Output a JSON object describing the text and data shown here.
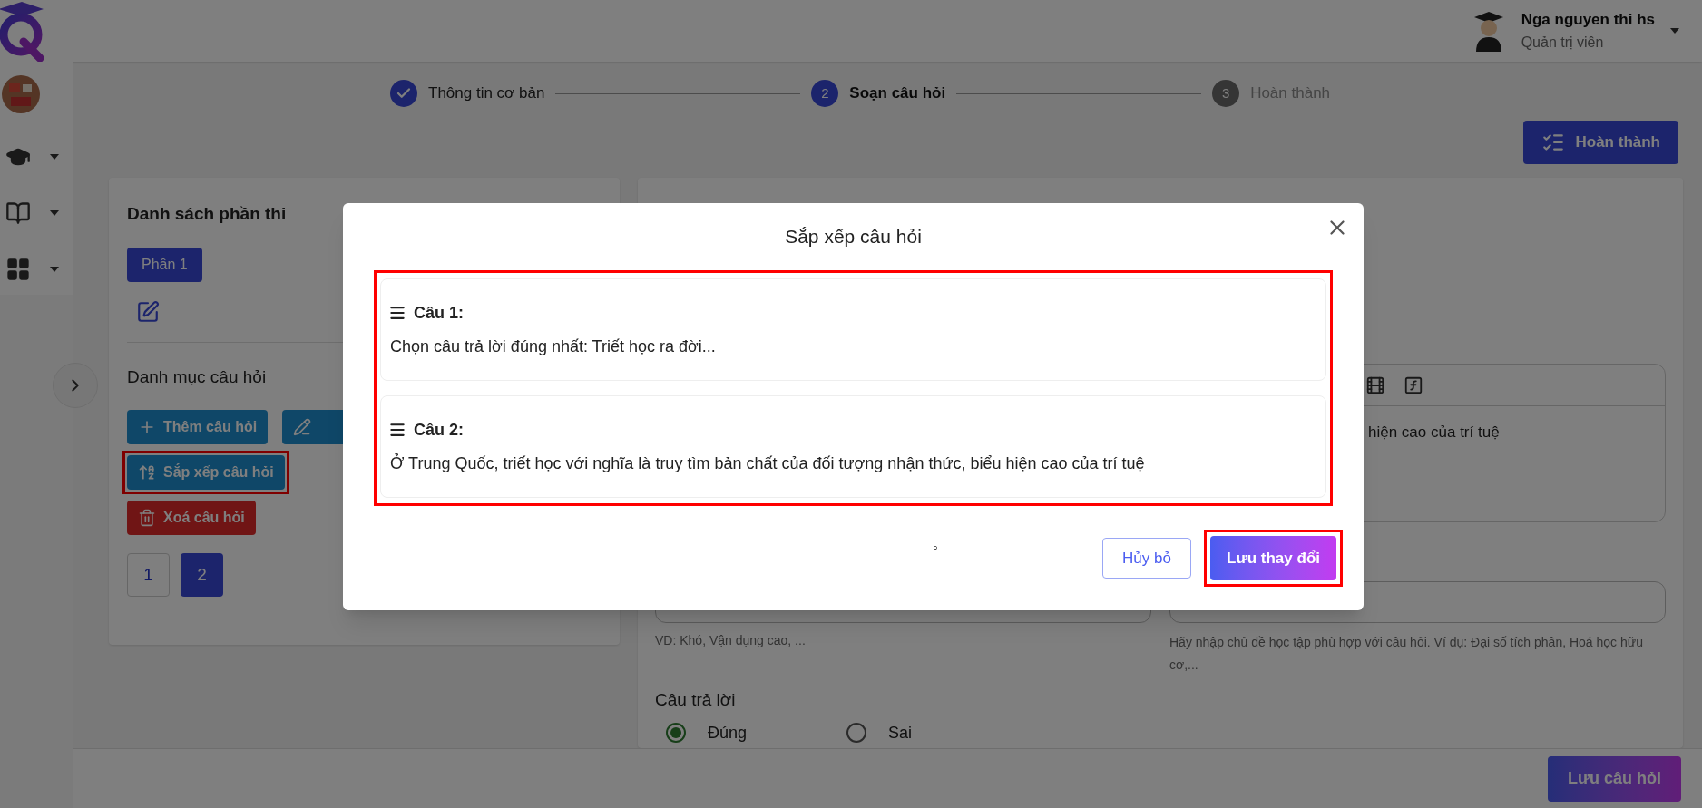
{
  "header": {
    "user_name": "Nga nguyen thi hs",
    "user_role": "Quản trị viên"
  },
  "stepper": [
    {
      "label": "Thông tin cơ bản",
      "kind": "done"
    },
    {
      "number": "2",
      "label": "Soạn câu hỏi",
      "kind": "current"
    },
    {
      "number": "3",
      "label": "Hoàn thành",
      "kind": "pending"
    }
  ],
  "finish_button": "Hoàn thành",
  "sections_panel": {
    "title": "Danh sách phần thi",
    "sections": [
      {
        "label": "Phần 1",
        "selected": true
      }
    ],
    "category_title": "Danh mục câu hỏi",
    "actions": [
      {
        "kind": "add",
        "label": "Thêm câu hỏi",
        "highlighted": false
      },
      {
        "kind": "edit",
        "highlighted": false
      },
      {
        "kind": "sort",
        "label": "Sắp xếp câu hỏi",
        "highlighted": true
      },
      {
        "kind": "delete",
        "label": "Xoá câu hỏi",
        "highlighted": false
      }
    ],
    "pages": [
      {
        "label": "1",
        "selected": false
      },
      {
        "label": "2",
        "selected": true
      }
    ]
  },
  "editor": {
    "content": "hiện cao của trí tuệ",
    "difficulty_hint": "VD: Khó, Vận dụng cao, ...",
    "topic_hint": "Hãy nhập chủ đề học tập phù hợp với câu hỏi. Ví dụ: Đại số tích phân, Hoá học hữu cơ,...",
    "answer_title": "Câu trả lời",
    "answers": [
      {
        "label": "Đúng",
        "selected": true
      },
      {
        "label": "Sai",
        "selected": false
      }
    ]
  },
  "save_button": "Lưu câu hỏi",
  "modal": {
    "title": "Sắp xếp câu hỏi",
    "list_highlighted": true,
    "questions": [
      {
        "label": "Câu 1:",
        "text": "Chọn câu trả lời đúng nhất: Triết học ra đời..."
      },
      {
        "label": "Câu 2:",
        "text": "Ở Trung Quốc, triết học với nghĩa là truy tìm bản chất của đối tượng nhận thức, biểu hiện cao của trí tuệ"
      }
    ],
    "footer_mark": "◦",
    "cancel_button": "Hủy bỏ",
    "save_button": {
      "label": "Lưu thay đổi",
      "highlighted": true
    }
  }
}
